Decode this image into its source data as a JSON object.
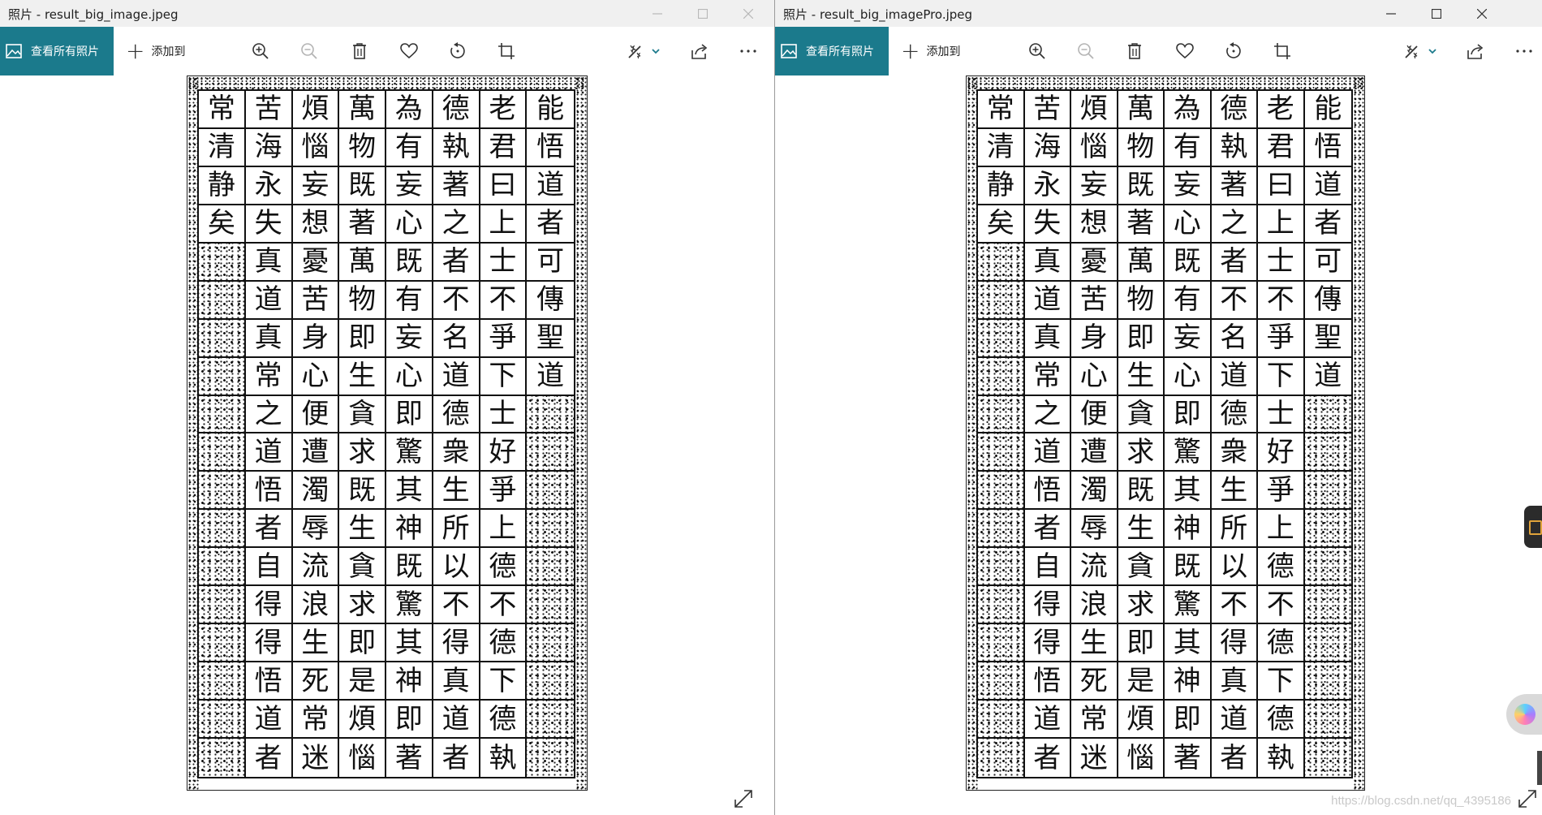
{
  "windows": [
    {
      "id": "left",
      "title": "照片 - result_big_image.jpeg",
      "toolbar": {
        "view_all": "查看所有照片",
        "add_to": "添加到"
      },
      "edge_speckle_rows": [
        3,
        4,
        5,
        6,
        7,
        8,
        9,
        10,
        11,
        12,
        13,
        14,
        15,
        16,
        17
      ]
    },
    {
      "id": "right",
      "title": "照片 - result_big_imagePro.jpeg",
      "toolbar": {
        "view_all": "查看所有照片",
        "add_to": "添加到"
      },
      "edge_speckle_rows": [
        4,
        5,
        6,
        7,
        8,
        9,
        10,
        11,
        12,
        13,
        14,
        15,
        16,
        17
      ]
    }
  ],
  "manuscript": {
    "columns": [
      [
        "能",
        "悟",
        "道",
        "者",
        "可",
        "傳",
        "聖",
        "道",
        "",
        "",
        "",
        "",
        "",
        "",
        "",
        "",
        "",
        ""
      ],
      [
        "老",
        "君",
        "曰",
        "上",
        "士",
        "不",
        "爭",
        "下",
        "士",
        "好",
        "爭",
        "上",
        "德",
        "不",
        "德",
        "下",
        "德",
        "執"
      ],
      [
        "德",
        "執",
        "著",
        "之",
        "者",
        "不",
        "名",
        "道",
        "德",
        "衆",
        "生",
        "所",
        "以",
        "不",
        "得",
        "真",
        "道",
        "者"
      ],
      [
        "為",
        "有",
        "妄",
        "心",
        "既",
        "有",
        "妄",
        "心",
        "即",
        "驚",
        "其",
        "神",
        "既",
        "驚",
        "其",
        "神",
        "即",
        "著"
      ],
      [
        "萬",
        "物",
        "既",
        "著",
        "萬",
        "物",
        "即",
        "生",
        "貪",
        "求",
        "既",
        "生",
        "貪",
        "求",
        "即",
        "是",
        "煩",
        "惱"
      ],
      [
        "煩",
        "惱",
        "妄",
        "想",
        "憂",
        "苦",
        "身",
        "心",
        "便",
        "遭",
        "濁",
        "辱",
        "流",
        "浪",
        "生",
        "死",
        "常",
        "迷"
      ],
      [
        "苦",
        "海",
        "永",
        "失",
        "真",
        "道",
        "真",
        "常",
        "之",
        "道",
        "悟",
        "者",
        "自",
        "得",
        "得",
        "悟",
        "道",
        "者"
      ],
      [
        "常",
        "清",
        "静",
        "矣",
        "",
        "",
        "",
        "",
        "",
        "",
        "",
        "",
        "",
        "",
        "",
        "",
        "",
        ""
      ]
    ]
  },
  "footer": {
    "watermark": "https://blog.csdn.net/qq_4395186"
  }
}
